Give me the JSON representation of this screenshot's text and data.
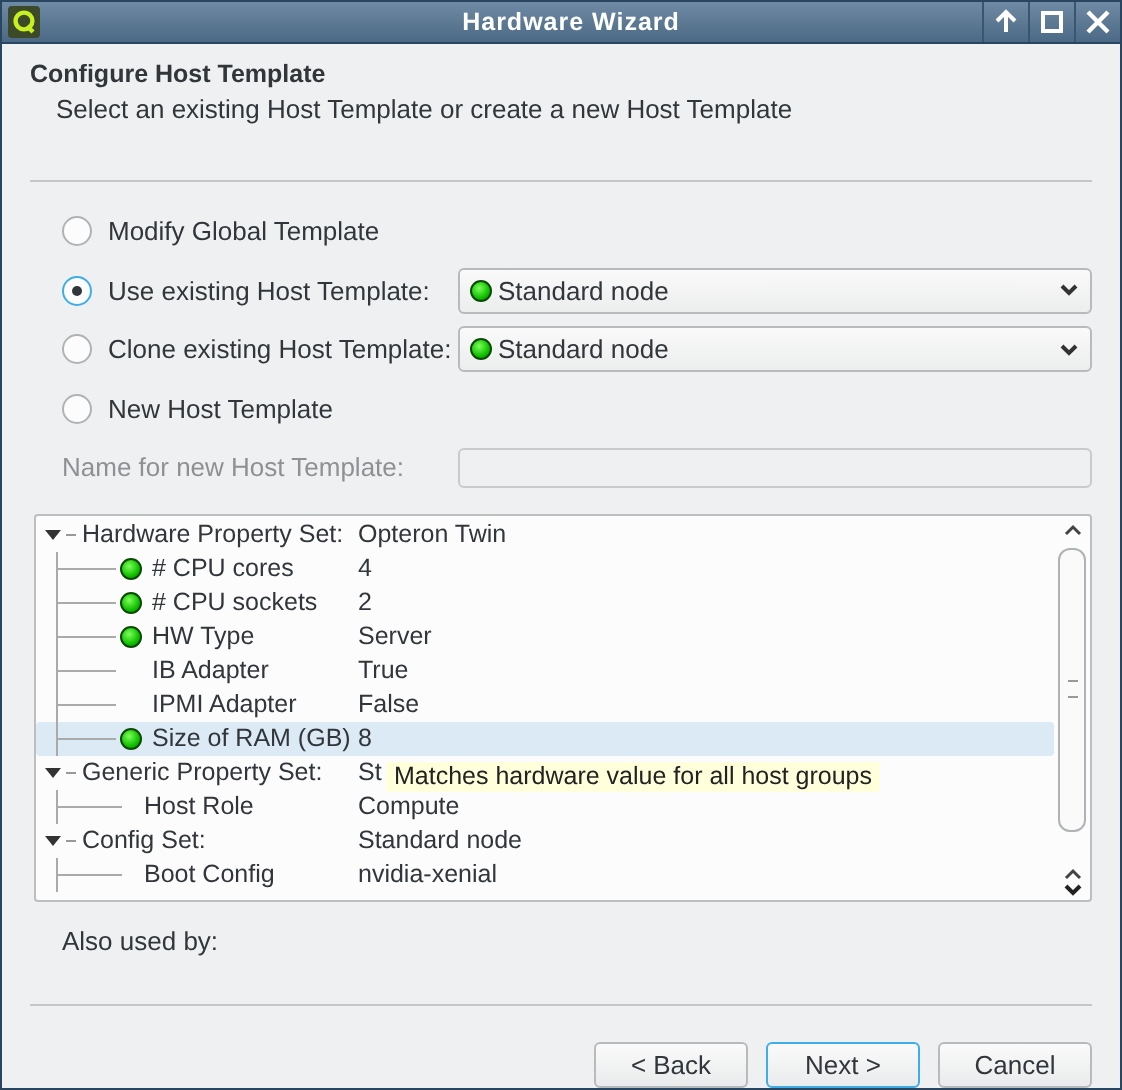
{
  "window": {
    "title": "Hardware Wizard"
  },
  "header": {
    "title": "Configure Host Template",
    "subtitle": "Select an existing Host Template or create a new Host Template"
  },
  "options": [
    {
      "label": "Modify Global Template",
      "selected": false
    },
    {
      "label": "Use existing Host Template:",
      "selected": true,
      "dropdown": {
        "value": "Standard node",
        "status_dot": true
      }
    },
    {
      "label": "Clone existing Host Template:",
      "selected": false,
      "dropdown": {
        "value": "Standard node",
        "status_dot": true
      }
    },
    {
      "label": "New Host Template",
      "selected": false
    }
  ],
  "name_field": {
    "label": "Name for new Host Template:",
    "disabled": true
  },
  "tree": {
    "rows": [
      {
        "label": "Hardware Property Set:",
        "value": "Opteron Twin",
        "expanded": true,
        "children": [
          {
            "label": "# CPU cores",
            "value": "4",
            "status_dot": true,
            "selected": false
          },
          {
            "label": "# CPU sockets",
            "value": "2",
            "status_dot": true,
            "selected": false
          },
          {
            "label": "HW Type",
            "value": "Server",
            "status_dot": true,
            "selected": false
          },
          {
            "label": "IB Adapter",
            "value": "True",
            "status_dot": false,
            "selected": false
          },
          {
            "label": "IPMI Adapter",
            "value": "False",
            "status_dot": false,
            "selected": false
          },
          {
            "label": "Size of RAM (GB)",
            "value": "8",
            "status_dot": true,
            "selected": true
          }
        ]
      },
      {
        "label": "Generic Property Set:",
        "value": "St",
        "expanded": true,
        "children": [
          {
            "label": "Host Role",
            "value": "Compute",
            "selected": false
          }
        ]
      },
      {
        "label": "Config Set:",
        "value": "Standard node",
        "expanded": true,
        "children": [
          {
            "label": "Boot Config",
            "value": "nvidia-xenial",
            "selected": false
          }
        ]
      }
    ],
    "tooltip": "Matches hardware value for all host groups"
  },
  "also_used_by": "Also used by:",
  "buttons": [
    {
      "label": "< Back",
      "kind": "normal"
    },
    {
      "label": "Next >",
      "kind": "default"
    },
    {
      "label": "Cancel",
      "kind": "normal"
    }
  ]
}
